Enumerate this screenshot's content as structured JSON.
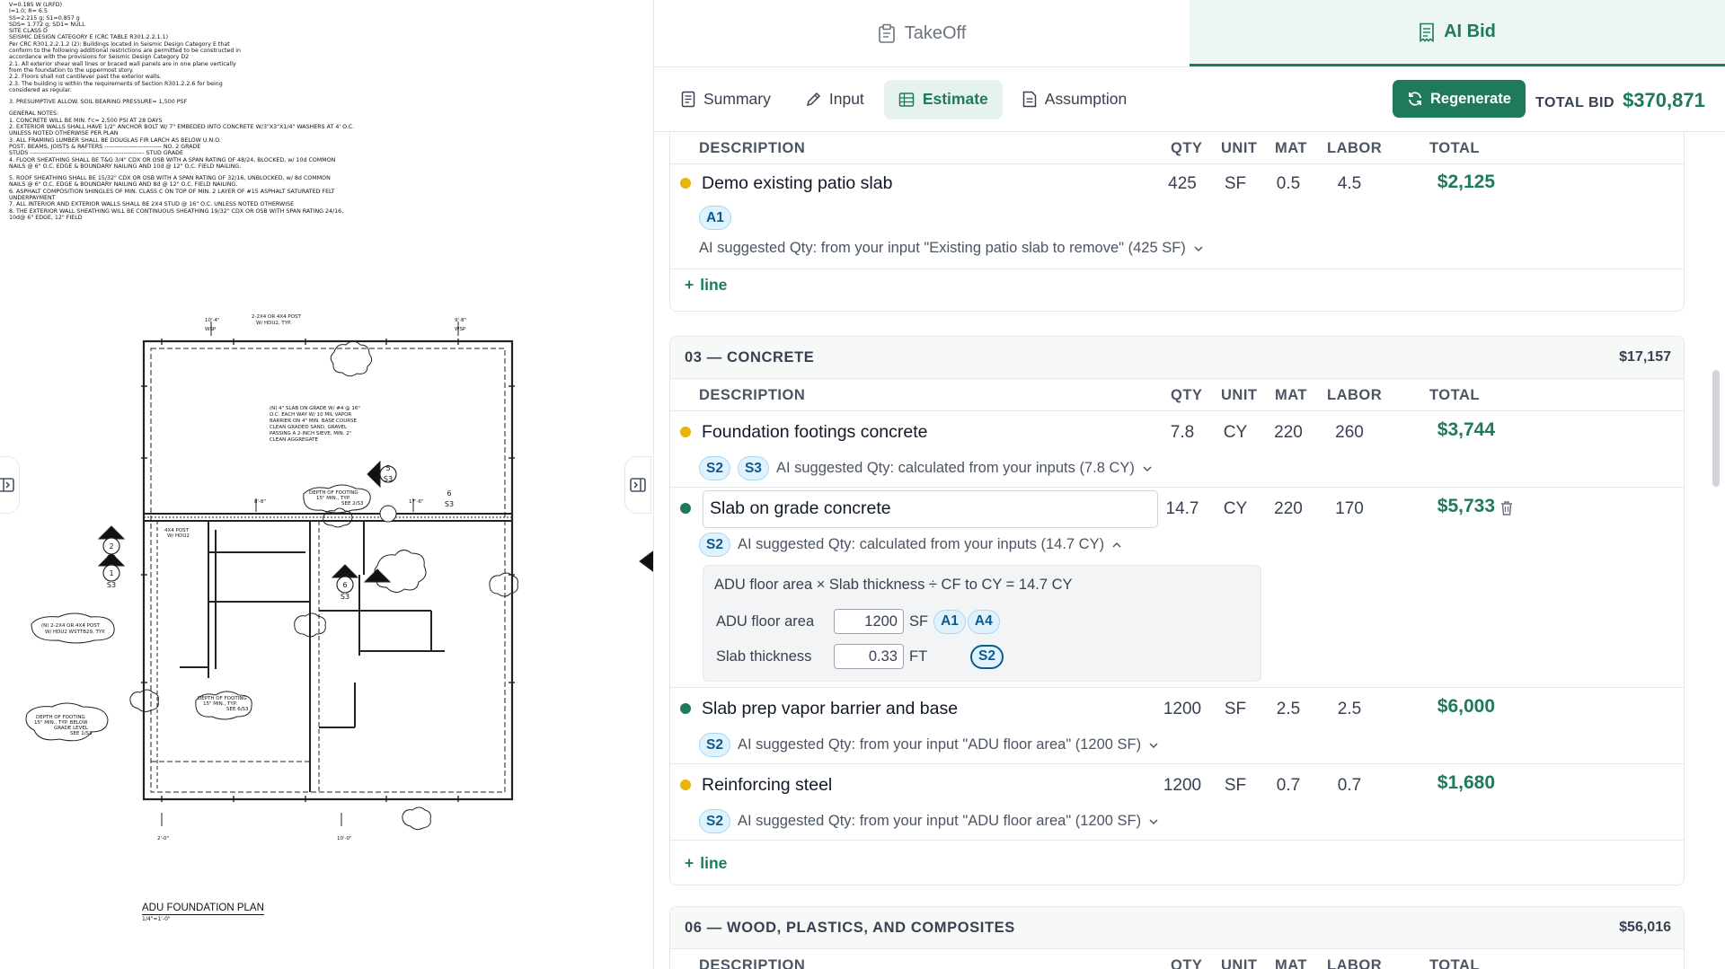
{
  "drawing": {
    "notes": [
      "V=0.185 W (LRFD)",
      "I=1.0; R= 6.5",
      "SS=2.215 g; S1=0.857 g",
      "SDS= 1.772 g; SD1= NULL",
      "SITE CLASS D",
      "SEISMIC DESIGN CATEGORY E (CRC TABLE R301.2.2.1.1)",
      "Per CRC R301.2.2.1.2 (2): Buildings located in Seismic Design Category E that",
      "conform to the following additional restrictions are permitted to be constructed in",
      "accordance with the provisions for Seismic Design Category D2",
      "2.1.   All exterior shear wall lines or braced wall panels are in one plane vertically",
      "          from the foundation to the uppermost story.",
      "2.2.   Floors shall not cantilever past the exterior walls.",
      "2.3.   The building is within the requirements of Section R301.2.2.6 for being",
      "          considered as regular.",
      "",
      "3.   PRESUMPTIVE ALLOW. SOIL BEARING PRESSURE= 1,500 PSF",
      "",
      "GENERAL NOTES:",
      "1.   CONCRETE WILL BE MIN. f'c= 2,500 PSI AT 28 DAYS",
      "2.   EXTERIOR WALLS SHALL HAVE 1/2\" ANCHOR BOLT W/ 7\" EMBEDED INTO CONCRETE W/3\"X3\"X1/4\" WASHERS AT 4' O.C.",
      "       UNLESS NOTED OTHERWISE PER PLAN",
      "3.   ALL FRAMING LUMBER SHALL BE DOUGLAS FIR LARCH AS BELOW U.N.O.",
      "          POST, BEAMS, JOISTS & RAFTERS ---------------------------- NO. 2 GRADE",
      "          STUDS -------------------------------------------------------- STUD GRADE",
      "4.   FLOOR SHEATHING SHALL BE T&G 3/4\" CDX OR OSB WITH A SPAN RATING OF 48/24, BLOCKED, w/ 10d COMMON",
      "       NAILS @ 6\" O.C. EDGE & BOUNDARY NAILING AND 10d @ 12\" O.C. FIELD NAILING.",
      "",
      "5.   ROOF SHEATHING SHALL BE 15/32\" CDX OR OSB WITH A SPAN RATING OF 32/16, UNBLOCKED, w/ 8d COMMON",
      "       NAILS @ 6\" O.C. EDGE & BOUNDARY NAILING AND 8d @ 12\" O.C. FIELD NAILING.",
      "6.   ASPHALT COMPOSITION SHINGLES OF MIN. CLASS C ON TOP OF  MIN. 2 LAYER OF #15 ASPHALT SATURATED FELT",
      "       UNDERPAYMENT",
      "7.   ALL INTERIOR AND EXTERIOR WALLS SHALL BE 2X4 STUD @ 16\" O.C. UNLESS NOTED OTHERWISE",
      "8.   THE EXTERIOR WALL SHEATHING WILL BE CONTINUOUS SHEATHING 19/32\" CDX OR OSB WITH SPAN RATING 24/16,",
      "       10d@ 6\" EDGE, 12\" FIELD"
    ],
    "sheet_title": "ADU FOUNDATION PLAN",
    "sheet_scale": "1/4\"=1'-0\"",
    "callouts": {
      "slab": [
        "(N) 4\" SLAB ON GRADE W/ #4 @ 16\"",
        "O.C. EACH WAY W/ 10 MIL VAPOR",
        "BARRIER ON 4\" MIN. BASE COURSE",
        "CLEAN GRADED SAND, GRAVEL",
        "PASSING A 2-INCH SIEVE, MIN. 2\"",
        "CLEAN AGGREGATE"
      ],
      "post_top": [
        "2-2X4 OR 4X4 POST",
        "W/ HDU2, TYP."
      ],
      "post_left": [
        "(N)    2-2X4 OR 4X4 POST",
        "W/ HDU2 WSTTB29, TYP."
      ],
      "post_small": [
        "4X4 POST",
        "W/ HDU2"
      ],
      "footing_mid": [
        "DEPTH OF FOOTING",
        "15\" MIN., TYP.",
        "SEE 2/S3"
      ],
      "footing_low": [
        "DEPTH OF FOOTING",
        "15\" MIN., TYP.",
        "SEE 6/S3"
      ],
      "footing_left": [
        "DEPTH OF FOOTING",
        "15\" MIN., TYP. BELOW",
        "GRADE LEVEL",
        "SEE 1/S3"
      ],
      "section_marks": [
        {
          "num": "2",
          "sheet": "S3"
        },
        {
          "num": "1",
          "sheet": "S3"
        },
        {
          "num": "5",
          "sheet": "S3"
        },
        {
          "num": "6",
          "sheet": "S3"
        },
        {
          "num": "6",
          "sheet": "S3"
        }
      ],
      "dims": [
        "10'-4\"",
        "9'-8\"",
        "8'-8\"",
        "17'-6\"",
        "2'-0\"",
        "10'-0\"",
        "WSP",
        "WSP"
      ]
    }
  },
  "tabs": {
    "takeoff": "TakeOff",
    "ai_bid": "AI Bid"
  },
  "subtabs": {
    "summary": "Summary",
    "input": "Input",
    "estimate": "Estimate",
    "assumption": "Assumption"
  },
  "regenerate_label": "Regenerate",
  "total_bid": {
    "label": "TOTAL BID",
    "value": "$370,871"
  },
  "columns": {
    "description": "DESCRIPTION",
    "qty": "QTY",
    "unit": "UNIT",
    "mat": "MAT",
    "labor": "LABOR",
    "total": "TOTAL"
  },
  "add_line_label": "line",
  "section_demo": {
    "items": [
      {
        "description": "Demo existing patio slab",
        "qty": "425",
        "unit": "SF",
        "mat": "0.5",
        "labor": "4.5",
        "total": "$2,125",
        "chips": [
          "A1"
        ],
        "suggestion": "AI suggested Qty: from your input \"Existing patio slab to remove\" (425 SF)"
      }
    ]
  },
  "section_concrete": {
    "title": "03 — CONCRETE",
    "total": "$17,157",
    "items": [
      {
        "description": "Foundation footings concrete",
        "qty": "7.8",
        "unit": "CY",
        "mat": "220",
        "labor": "260",
        "total": "$3,744",
        "chips": [
          "S2",
          "S3"
        ],
        "suggestion": "AI suggested Qty: calculated from your inputs (7.8 CY)"
      },
      {
        "description": "Slab on grade concrete",
        "qty": "14.7",
        "unit": "CY",
        "mat": "220",
        "labor": "170",
        "total": "$5,733",
        "chips": [
          "S2"
        ],
        "suggestion": "AI suggested Qty: calculated from your inputs (14.7 CY)",
        "calc": {
          "formula": "ADU floor area × Slab thickness ÷ CF to CY = 14.7 CY",
          "var1": {
            "label": "ADU floor area",
            "value": "1200",
            "unit": "SF",
            "chips": [
              "A1",
              "A4"
            ]
          },
          "var2": {
            "label": "Slab thickness",
            "value": "0.33",
            "unit": "FT",
            "chips": [
              "S2"
            ]
          }
        }
      },
      {
        "description": "Slab prep vapor barrier and base",
        "qty": "1200",
        "unit": "SF",
        "mat": "2.5",
        "labor": "2.5",
        "total": "$6,000",
        "chips": [
          "S2"
        ],
        "suggestion": "AI suggested Qty: from your input \"ADU floor area\" (1200 SF)"
      },
      {
        "description": "Reinforcing steel",
        "qty": "1200",
        "unit": "SF",
        "mat": "0.7",
        "labor": "0.7",
        "total": "$1,680",
        "chips": [
          "S2"
        ],
        "suggestion": "AI suggested Qty: from your input \"ADU floor area\" (1200 SF)"
      }
    ]
  },
  "section_wood": {
    "title": "06 — WOOD, PLASTICS, AND COMPOSITES",
    "total": "$56,016"
  },
  "colors": {
    "accent": "#1f7a5a",
    "chip_bg": "#e0f2fe",
    "chip_text": "#0e5a8a",
    "dot_yellow": "#eab308",
    "dot_green": "#1f7a5a"
  }
}
